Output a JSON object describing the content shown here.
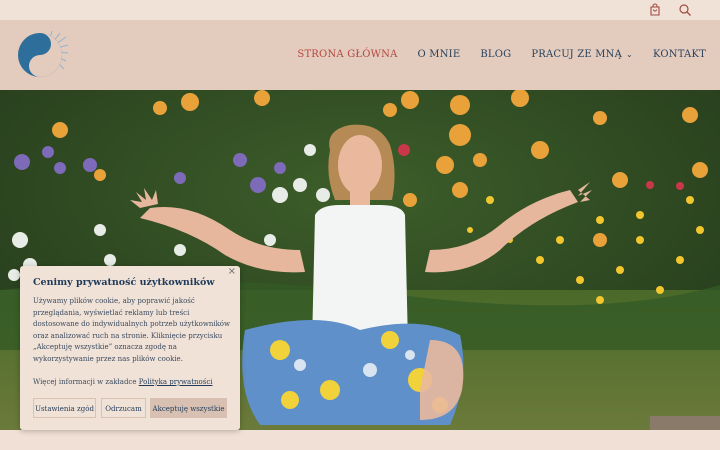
{
  "topbar": {
    "cart_icon": "shopping-bag-icon",
    "search_icon": "search-icon"
  },
  "nav": {
    "items": [
      {
        "label": "STRONA GŁÓWNA",
        "active": true
      },
      {
        "label": "O MNIE"
      },
      {
        "label": "BLOG"
      },
      {
        "label": "PRACUJ ZE MNĄ",
        "has_dropdown": true
      },
      {
        "label": "KONTAKT"
      }
    ]
  },
  "cookie": {
    "title": "Cenimy prywatność użytkowników",
    "body": "Używamy plików cookie, aby poprawić jakość przeglądania, wyświetlać reklamy lub treści dostosowane do indywidualnych potrzeb użytkowników oraz analizować ruch na stronie. Kliknięcie przycisku „Akceptuję wszystkie” oznacza zgodę na wykorzystywanie przez nas plików cookie.",
    "more_prefix": "Więcej informacji w zakładce",
    "more_link": "Polityka prywatności",
    "close": "×",
    "buttons": {
      "settings": "Ustawienia zgód",
      "reject": "Odrzucam",
      "accept": "Akceptuję wszystkie"
    }
  },
  "colors": {
    "header_bg": "#e3cbbd",
    "nav_text": "#28435e",
    "nav_active": "#b5473f",
    "logo_blue": "#2d6e9a"
  }
}
